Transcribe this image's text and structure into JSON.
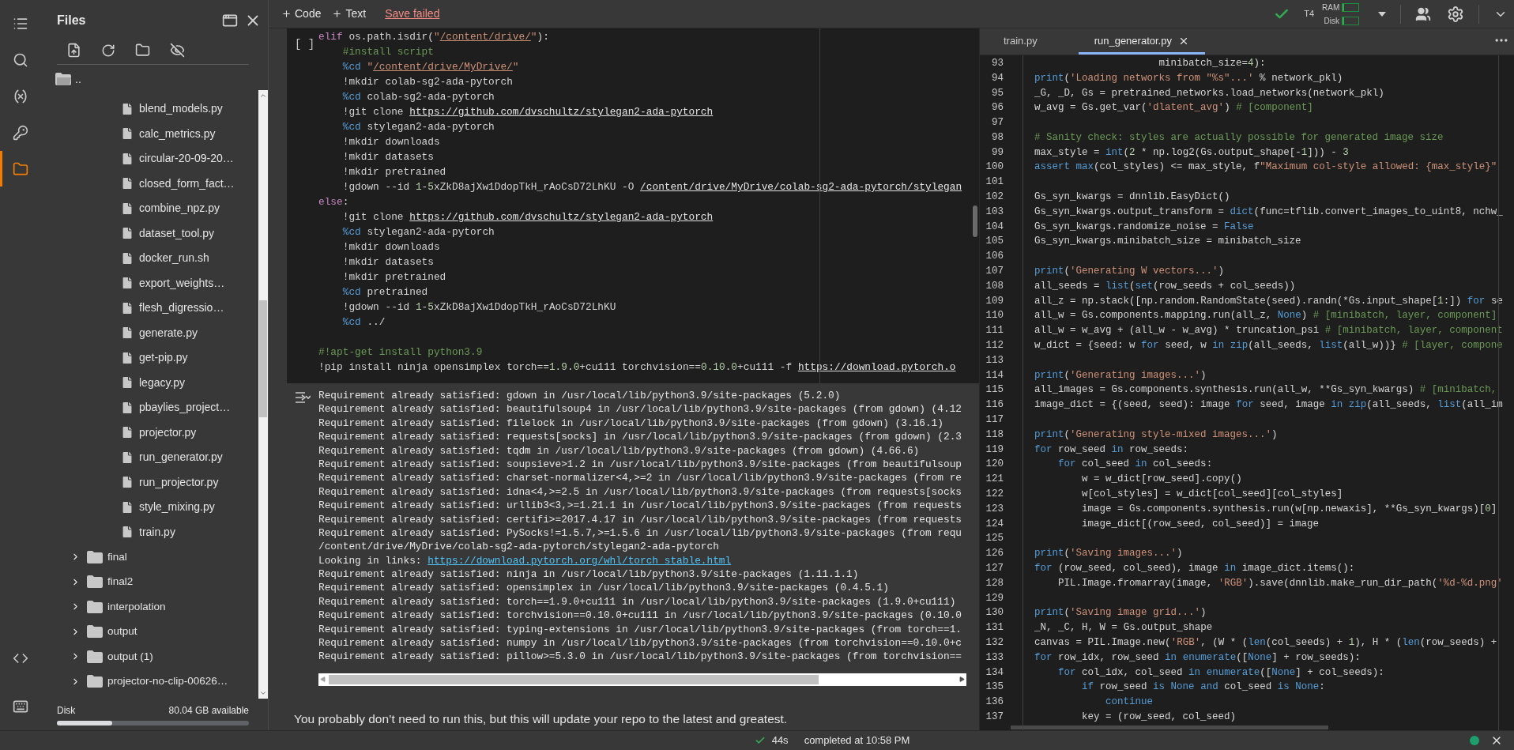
{
  "rail": [
    {
      "selected": false
    },
    {
      "selected": false
    },
    {
      "selected": false
    },
    {
      "selected": false
    },
    {
      "selected": true
    },
    {
      "selected": false
    },
    {
      "selected": false
    }
  ],
  "files_panel": {
    "title": "Files",
    "parent": "..",
    "tree": [
      {
        "children": [
          {
            "name": "blend_models.py"
          },
          {
            "name": "calc_metrics.py"
          },
          {
            "name": "circular-20-09-20…"
          },
          {
            "name": "closed_form_fact…"
          },
          {
            "name": "combine_npz.py"
          },
          {
            "name": "dataset_tool.py"
          },
          {
            "name": "docker_run.sh"
          },
          {
            "name": "export_weights…"
          },
          {
            "name": "flesh_digressio…"
          },
          {
            "name": "generate.py"
          },
          {
            "name": "get-pip.py"
          },
          {
            "name": "legacy.py"
          },
          {
            "name": "pbaylies_project…"
          },
          {
            "name": "projector.py"
          },
          {
            "name": "run_generator.py"
          },
          {
            "name": "run_projector.py"
          },
          {
            "name": "style_mixing.py"
          },
          {
            "name": "train.py"
          }
        ]
      },
      {
        "name": "final",
        "expanded": false
      },
      {
        "name": "final2",
        "expanded": false
      },
      {
        "name": "interpolation",
        "expanded": false
      },
      {
        "name": "output",
        "expanded": false
      },
      {
        "name": "output (1)",
        "expanded": false
      },
      {
        "name": "projector-no-clip-00626…",
        "expanded": false
      }
    ],
    "disk": {
      "label": "Disk",
      "available": "80.04 GB available",
      "level": 0.29
    }
  },
  "toolbar": {
    "buttons": [
      {
        "label": "Code"
      },
      {
        "label": "Text"
      }
    ],
    "save_status": "Save failed"
  },
  "runtime": {
    "connected": true,
    "accelerator": "T4",
    "ram": {
      "label": "RAM",
      "level": 0.08
    },
    "disk": {
      "label": "Disk",
      "level": 0.12
    }
  },
  "cell": {
    "run_label": "[ ]",
    "lines": [
      {
        "kind": "code",
        "parts": [
          {
            "text": "elif os.path.isdir(\""
          },
          {
            "text": "/content/drive/",
            "kind": "path"
          },
          {
            "text": "\"):"
          }
        ]
      },
      {
        "kind": "code",
        "parts": [
          {
            "text": "    #install script"
          }
        ]
      },
      {
        "kind": "code",
        "parts": [
          {
            "text": "    %cd \""
          },
          {
            "text": "/content/drive/MyDrive/",
            "kind": "path"
          },
          {
            "text": "\""
          }
        ]
      },
      {
        "kind": "code",
        "parts": [
          {
            "text": "    !mkdir colab-sg2-ada-pytorch"
          }
        ]
      },
      {
        "kind": "code",
        "parts": [
          {
            "text": "    %cd colab-sg2-ada-pytorch"
          }
        ]
      },
      {
        "kind": "code",
        "parts": [
          {
            "text": "    !git clone "
          },
          {
            "text": "https://github.com/dvschultz/stylegan2-ada-pytorch",
            "kind": "link"
          }
        ]
      },
      {
        "kind": "code",
        "parts": [
          {
            "text": "    %cd stylegan2-ada-pytorch"
          }
        ]
      },
      {
        "kind": "code",
        "parts": [
          {
            "text": "    !mkdir downloads"
          }
        ]
      },
      {
        "kind": "code",
        "parts": [
          {
            "text": "    !mkdir datasets"
          }
        ]
      },
      {
        "kind": "code",
        "parts": [
          {
            "text": "    !mkdir pretrained"
          }
        ]
      },
      {
        "kind": "code",
        "parts": [
          {
            "text": "    !gdown --id 1-5xZkD8ajXw1DdopTkH_rAoCsD72LhKU -O "
          },
          {
            "text": "/content/drive/MyDrive/colab-sg2-ada-pytorch/stylegan",
            "kind": "link"
          }
        ]
      },
      {
        "kind": "code",
        "parts": [
          {
            "text": "else:"
          }
        ]
      },
      {
        "kind": "code",
        "parts": [
          {
            "text": "    !git clone "
          },
          {
            "text": "https://github.com/dvschultz/stylegan2-ada-pytorch",
            "kind": "link"
          }
        ]
      },
      {
        "kind": "code",
        "parts": [
          {
            "text": "    %cd stylegan2-ada-pytorch"
          }
        ]
      },
      {
        "kind": "code",
        "parts": [
          {
            "text": "    !mkdir downloads"
          }
        ]
      },
      {
        "kind": "code",
        "parts": [
          {
            "text": "    !mkdir datasets"
          }
        ]
      },
      {
        "kind": "code",
        "parts": [
          {
            "text": "    !mkdir pretrained"
          }
        ]
      },
      {
        "kind": "code",
        "parts": [
          {
            "text": "    %cd pretrained"
          }
        ]
      },
      {
        "kind": "code",
        "parts": [
          {
            "text": "    !gdown --id 1-5xZkD8ajXw1DdopTkH_rAoCsD72LhKU"
          }
        ]
      },
      {
        "kind": "code",
        "parts": [
          {
            "text": "    %cd ../"
          }
        ]
      },
      {
        "kind": "blank"
      },
      {
        "kind": "code",
        "parts": [
          {
            "text": "#!apt-get install python3.9"
          }
        ]
      },
      {
        "kind": "code",
        "parts": [
          {
            "text": "!pip install ninja opensimplex torch==1.9.0+cu111 torchvision==0.10.0+cu111 -f "
          },
          {
            "text": "https://download.pytorch.o",
            "kind": "link"
          }
        ]
      }
    ]
  },
  "output": {
    "lines": [
      {
        "text": "Requirement already satisfied: gdown in /usr/local/lib/python3.9/site-packages (5.2.0)"
      },
      {
        "text": "Requirement already satisfied: beautifulsoup4 in /usr/local/lib/python3.9/site-packages (from gdown) (4.12"
      },
      {
        "text": "Requirement already satisfied: filelock in /usr/local/lib/python3.9/site-packages (from gdown) (3.16.1)"
      },
      {
        "text": "Requirement already satisfied: requests[socks] in /usr/local/lib/python3.9/site-packages (from gdown) (2.3"
      },
      {
        "text": "Requirement already satisfied: tqdm in /usr/local/lib/python3.9/site-packages (from gdown) (4.66.6)"
      },
      {
        "text": "Requirement already satisfied: soupsieve>1.2 in /usr/local/lib/python3.9/site-packages (from beautifulsoup"
      },
      {
        "text": "Requirement already satisfied: charset-normalizer<4,>=2 in /usr/local/lib/python3.9/site-packages (from re"
      },
      {
        "text": "Requirement already satisfied: idna<4,>=2.5 in /usr/local/lib/python3.9/site-packages (from requests[socks"
      },
      {
        "text": "Requirement already satisfied: urllib3<3,>=1.21.1 in /usr/local/lib/python3.9/site-packages (from requests"
      },
      {
        "text": "Requirement already satisfied: certifi>=2017.4.17 in /usr/local/lib/python3.9/site-packages (from requests"
      },
      {
        "text": "Requirement already satisfied: PySocks!=1.5.7,>=1.5.6 in /usr/local/lib/python3.9/site-packages (from requ"
      },
      {
        "text": "/content/drive/MyDrive/colab-sg2-ada-pytorch/stylegan2-ada-pytorch"
      },
      {
        "text": "Looking in links: ",
        "link": "https://download.pytorch.org/whl/torch_stable.html"
      },
      {
        "text": "Requirement already satisfied: ninja in /usr/local/lib/python3.9/site-packages (1.11.1.1)"
      },
      {
        "text": "Requirement already satisfied: opensimplex in /usr/local/lib/python3.9/site-packages (0.4.5.1)"
      },
      {
        "text": "Requirement already satisfied: torch==1.9.0+cu111 in /usr/local/lib/python3.9/site-packages (1.9.0+cu111)"
      },
      {
        "text": "Requirement already satisfied: torchvision==0.10.0+cu111 in /usr/local/lib/python3.9/site-packages (0.10.0"
      },
      {
        "text": "Requirement already satisfied: typing-extensions in /usr/local/lib/python3.9/site-packages (from torch==1."
      },
      {
        "text": "Requirement already satisfied: numpy in /usr/local/lib/python3.9/site-packages (from torchvision==0.10.0+c"
      },
      {
        "text": "Requirement already satisfied: pillow>=5.3.0 in /usr/local/lib/python3.9/site-packages (from torchvision=="
      }
    ]
  },
  "text_cell": "You probably don’t need to run this, but this will update your repo to the latest and greatest.",
  "editor": {
    "tabs": [
      {
        "label": "train.py",
        "selected": false
      },
      {
        "label": "run_generator.py",
        "selected": true
      }
    ],
    "lines": [
      {
        "n": "93",
        "code": "                     minibatch_size=4):"
      },
      {
        "n": "94",
        "code": "print('Loading networks from \"%s\"...' % network_pkl)"
      },
      {
        "n": "95",
        "code": "_G, _D, Gs = pretrained_networks.load_networks(network_pkl)"
      },
      {
        "n": "96",
        "code": "w_avg = Gs.get_var('dlatent_avg') # [component]"
      },
      {
        "n": "97"
      },
      {
        "n": "98",
        "code": "# Sanity check: styles are actually possible for generated image size"
      },
      {
        "n": "99",
        "code": "max_style = int(2 * np.log2(Gs.output_shape[-1])) - 3"
      },
      {
        "n": "100",
        "code": "assert max(col_styles) <= max_style, f\"Maximum col-style allowed: {max_style}\""
      },
      {
        "n": "101"
      },
      {
        "n": "102",
        "code": "Gs_syn_kwargs = dnnlib.EasyDict()"
      },
      {
        "n": "103",
        "code": "Gs_syn_kwargs.output_transform = dict(func=tflib.convert_images_to_uint8, nchw_"
      },
      {
        "n": "104",
        "code": "Gs_syn_kwargs.randomize_noise = False"
      },
      {
        "n": "105",
        "code": "Gs_syn_kwargs.minibatch_size = minibatch_size"
      },
      {
        "n": "106"
      },
      {
        "n": "107",
        "code": "print('Generating W vectors...')"
      },
      {
        "n": "108",
        "code": "all_seeds = list(set(row_seeds + col_seeds))"
      },
      {
        "n": "109",
        "code": "all_z = np.stack([np.random.RandomState(seed).randn(*Gs.input_shape[1:]) for se"
      },
      {
        "n": "110",
        "code": "all_w = Gs.components.mapping.run(all_z, None) # [minibatch, layer, component]"
      },
      {
        "n": "111",
        "code": "all_w = w_avg + (all_w - w_avg) * truncation_psi # [minibatch, layer, component"
      },
      {
        "n": "112",
        "code": "w_dict = {seed: w for seed, w in zip(all_seeds, list(all_w))} # [layer, compone"
      },
      {
        "n": "113"
      },
      {
        "n": "114",
        "code": "print('Generating images...')"
      },
      {
        "n": "115",
        "code": "all_images = Gs.components.synthesis.run(all_w, **Gs_syn_kwargs) # [minibatch,"
      },
      {
        "n": "116",
        "code": "image_dict = {(seed, seed): image for seed, image in zip(all_seeds, list(all_im"
      },
      {
        "n": "117"
      },
      {
        "n": "118",
        "code": "print('Generating style-mixed images...')"
      },
      {
        "n": "119",
        "code": "for row_seed in row_seeds:"
      },
      {
        "n": "120",
        "code": "    for col_seed in col_seeds:"
      },
      {
        "n": "121",
        "code": "        w = w_dict[row_seed].copy()"
      },
      {
        "n": "122",
        "code": "        w[col_styles] = w_dict[col_seed][col_styles]"
      },
      {
        "n": "123",
        "code": "        image = Gs.components.synthesis.run(w[np.newaxis], **Gs_syn_kwargs)[0]"
      },
      {
        "n": "124",
        "code": "        image_dict[(row_seed, col_seed)] = image"
      },
      {
        "n": "125"
      },
      {
        "n": "126",
        "code": "print('Saving images...')"
      },
      {
        "n": "127",
        "code": "for (row_seed, col_seed), image in image_dict.items():"
      },
      {
        "n": "128",
        "code": "    PIL.Image.fromarray(image, 'RGB').save(dnnlib.make_run_dir_path('%d-%d.png'"
      },
      {
        "n": "129"
      },
      {
        "n": "130",
        "code": "print('Saving image grid...')"
      },
      {
        "n": "131",
        "code": "_N, _C, H, W = Gs.output_shape"
      },
      {
        "n": "132",
        "code": "canvas = PIL.Image.new('RGB', (W * (len(col_seeds) + 1), H * (len(row_seeds) +"
      },
      {
        "n": "133",
        "code": "for row_idx, row_seed in enumerate([None] + row_seeds):"
      },
      {
        "n": "134",
        "code": "    for col_idx, col_seed in enumerate([None] + col_seeds):"
      },
      {
        "n": "135",
        "code": "        if row_seed is None and col_seed is None:"
      },
      {
        "n": "136",
        "code": "            continue"
      },
      {
        "n": "137",
        "code": "        key = (row_seed, col_seed)"
      }
    ]
  },
  "status": {
    "done": true,
    "duration": "44s",
    "message": "completed at 10:58 PM"
  }
}
